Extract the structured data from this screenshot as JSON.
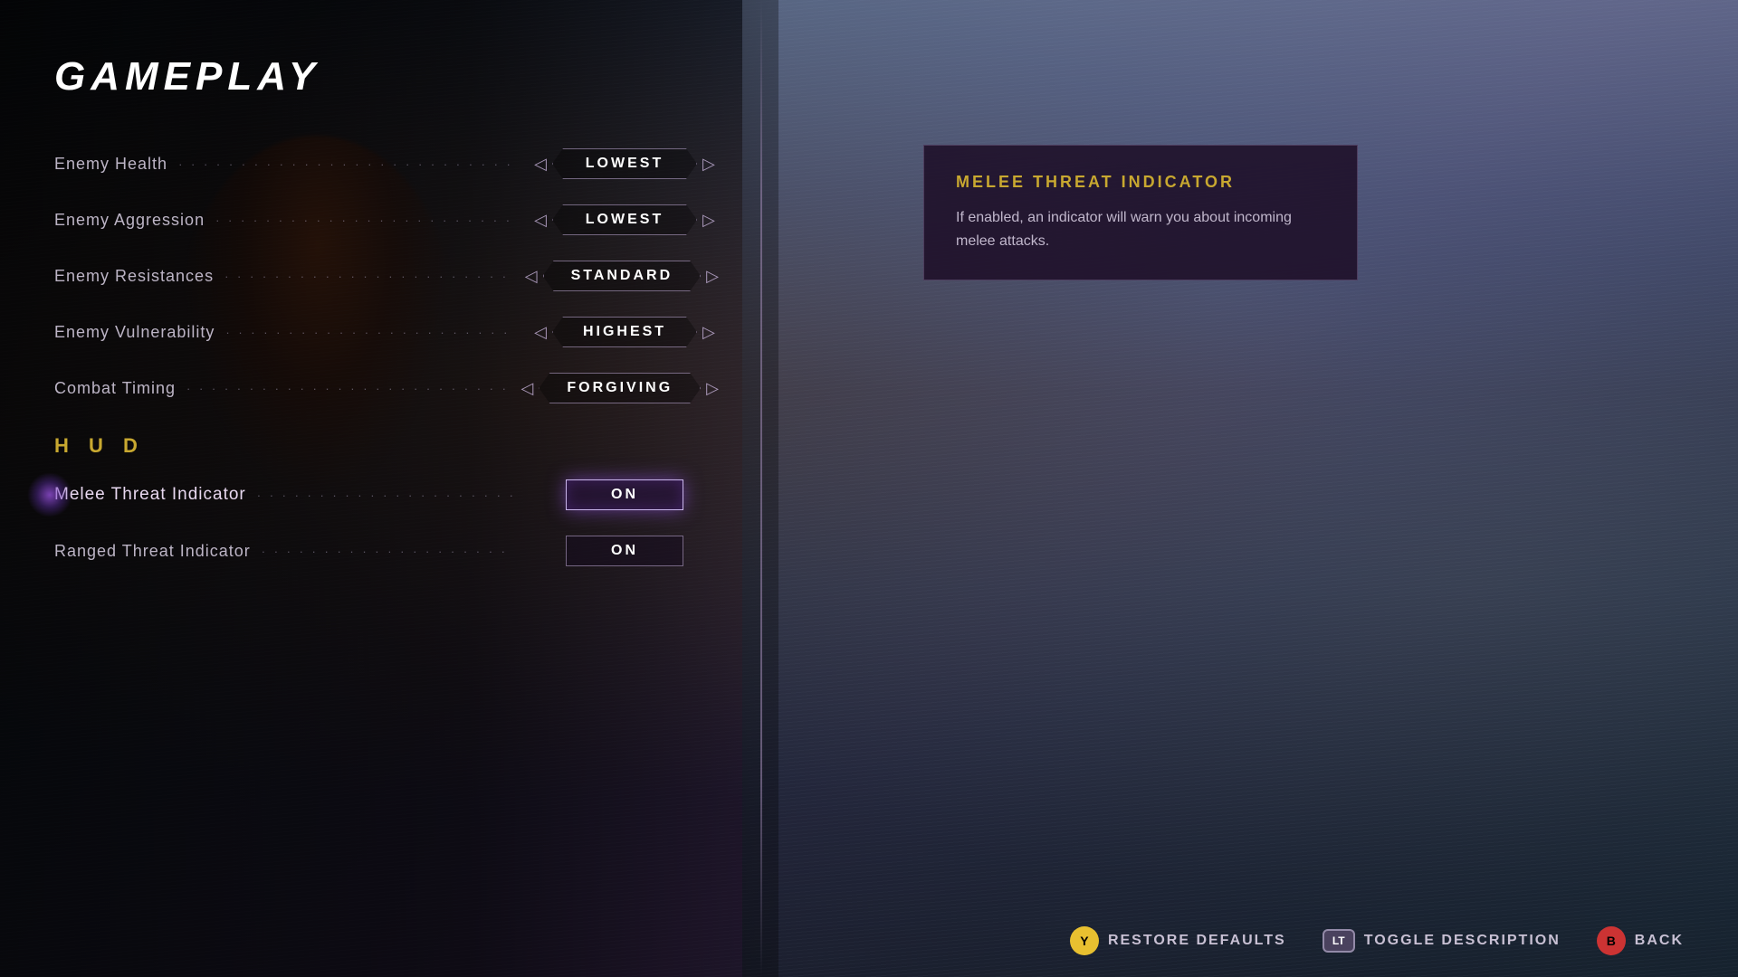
{
  "page": {
    "title": "GAMEPLAY"
  },
  "settings": {
    "combat_section": [
      {
        "id": "enemy-health",
        "label": "Enemy Health",
        "value": "LOWEST",
        "type": "selector",
        "active": false
      },
      {
        "id": "enemy-aggression",
        "label": "Enemy Aggression",
        "value": "LOWEST",
        "type": "selector",
        "active": false
      },
      {
        "id": "enemy-resistances",
        "label": "Enemy Resistances",
        "value": "STANDARD",
        "type": "selector",
        "active": false
      },
      {
        "id": "enemy-vulnerability",
        "label": "Enemy Vulnerability",
        "value": "HIGHEST",
        "type": "selector",
        "active": false
      },
      {
        "id": "combat-timing",
        "label": "Combat Timing",
        "value": "FORGIVING",
        "type": "selector",
        "active": false
      }
    ],
    "hud_header": "H U D",
    "hud_section": [
      {
        "id": "melee-threat-indicator",
        "label": "Melee Threat Indicator",
        "value": "ON",
        "type": "toggle",
        "active": true
      },
      {
        "id": "ranged-threat-indicator",
        "label": "Ranged Threat Indicator",
        "value": "ON",
        "type": "toggle",
        "active": false
      }
    ]
  },
  "description": {
    "title": "MELEE THREAT INDICATOR",
    "text": "If enabled, an indicator will warn you about incoming melee attacks."
  },
  "bottom_bar": {
    "actions": [
      {
        "id": "restore-defaults",
        "badge": "Y",
        "badge_class": "badge-y",
        "label": "RESTORE DEFAULTS"
      },
      {
        "id": "toggle-description",
        "badge": "LT",
        "badge_class": "badge-lt",
        "label": "TOGGLE DESCRIPTION"
      },
      {
        "id": "back",
        "badge": "B",
        "badge_class": "badge-b",
        "label": "BACK"
      }
    ]
  }
}
